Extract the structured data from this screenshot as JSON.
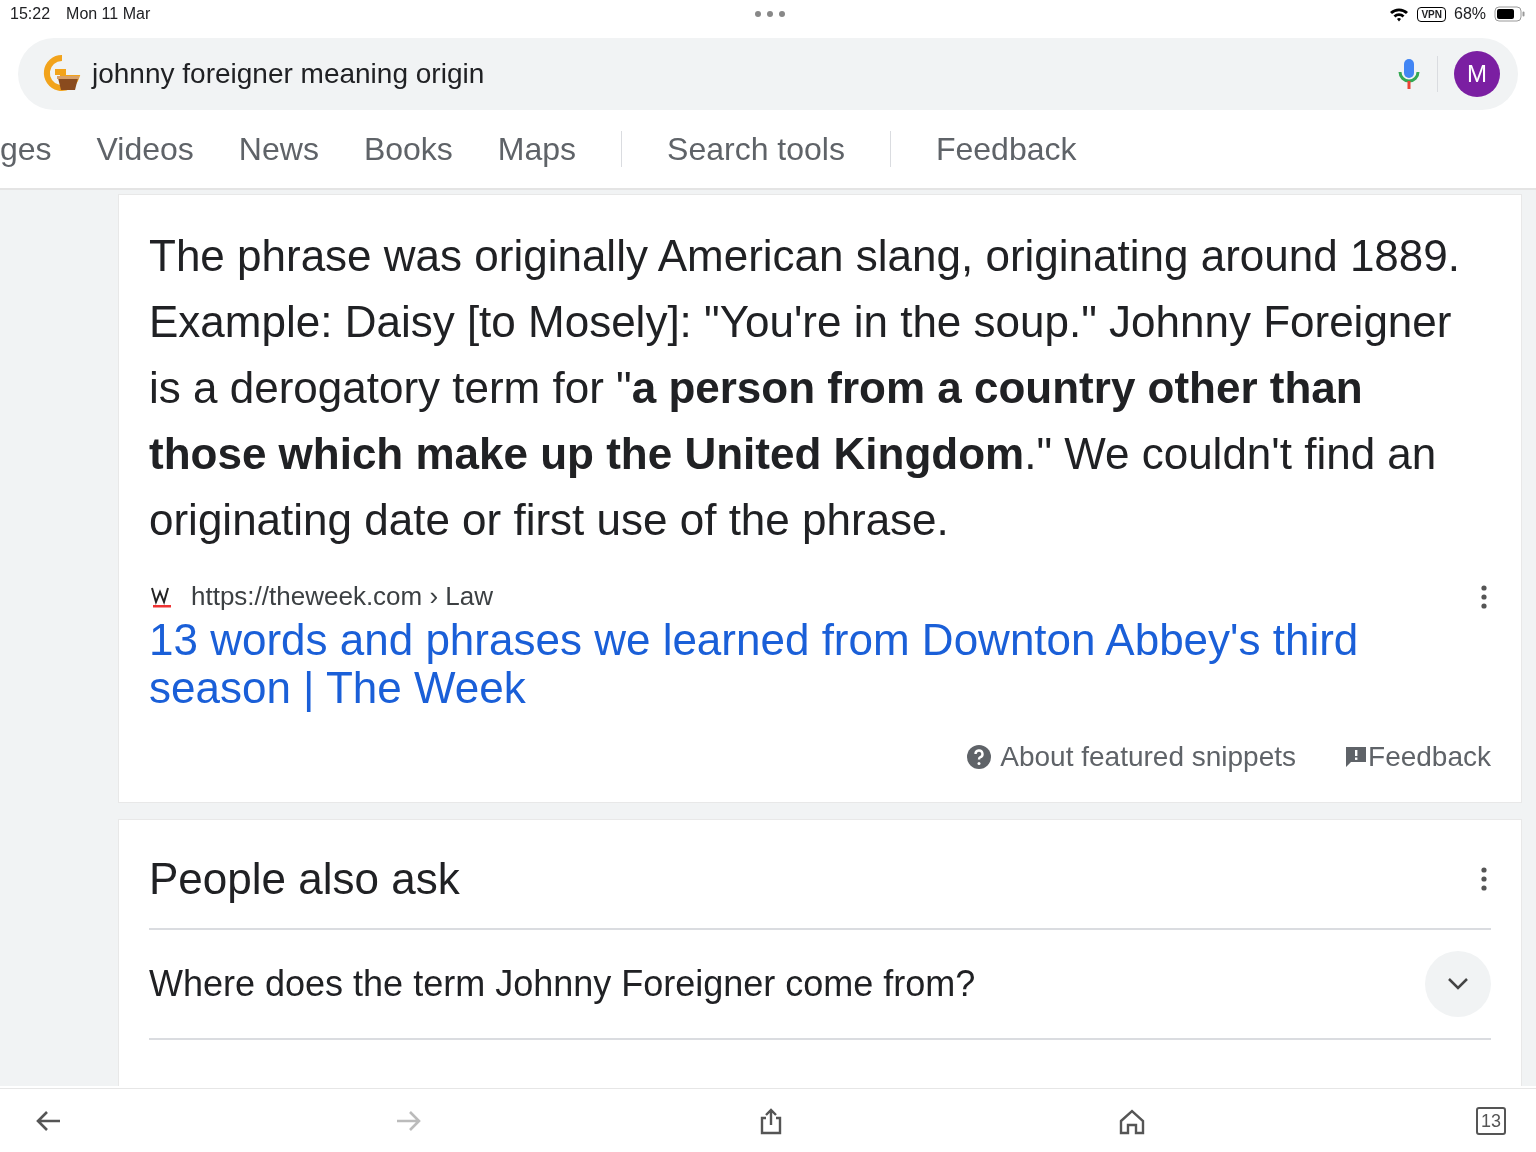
{
  "status_bar": {
    "time": "15:22",
    "date": "Mon 11 Mar",
    "vpn": "VPN",
    "battery": "68%"
  },
  "search": {
    "query": "johnny foreigner meaning origin",
    "avatar": "M"
  },
  "tabs": [
    {
      "label": "ges",
      "kind": "tab"
    },
    {
      "label": "Videos",
      "kind": "tab"
    },
    {
      "label": "News",
      "kind": "tab"
    },
    {
      "label": "Books",
      "kind": "tab"
    },
    {
      "label": "Maps",
      "kind": "tab"
    },
    {
      "label": "Search tools",
      "kind": "tool"
    },
    {
      "label": "Feedback",
      "kind": "tool"
    }
  ],
  "snippet": {
    "text": "The phrase was originally American slang, originating around 1889. Example: Daisy [to Mosely]: \"You're in the soup.\" Johnny Foreigner is a derogatory term for \"**a person from a country other than those which make up the United Kingdom**.\" We couldn't find an originating date or first use of the phrase.",
    "source_url": "https://theweek.com › Law",
    "title": "13 words and phrases we learned from Downton Abbey's third season | The Week",
    "about": "About featured snippets",
    "feedback": "Feedback"
  },
  "people_also_ask": {
    "heading": "People also ask",
    "questions": [
      {
        "text": "Where does the term Johnny Foreigner come from?",
        "expanded": false
      }
    ]
  },
  "toolbar": [
    {
      "kind": "back",
      "disabled": false
    },
    {
      "kind": "forward",
      "disabled": true
    },
    {
      "kind": "share",
      "disabled": false
    },
    {
      "kind": "home",
      "disabled": false
    },
    {
      "kind": "tabs",
      "label": "13",
      "disabled": false
    }
  ]
}
